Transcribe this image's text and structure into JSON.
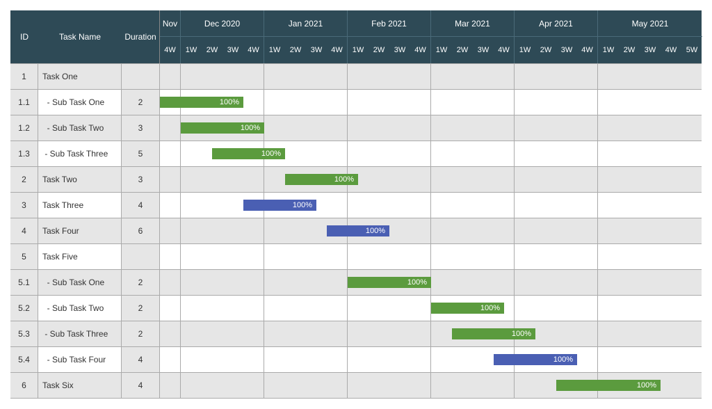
{
  "columns": {
    "id": "ID",
    "name": "Task Name",
    "duration": "Duration"
  },
  "months": [
    {
      "label": "Nov",
      "weeks": [
        "4W"
      ]
    },
    {
      "label": "Dec 2020",
      "weeks": [
        "1W",
        "2W",
        "3W",
        "4W"
      ]
    },
    {
      "label": "Jan 2021",
      "weeks": [
        "1W",
        "2W",
        "3W",
        "4W"
      ]
    },
    {
      "label": "Feb 2021",
      "weeks": [
        "1W",
        "2W",
        "3W",
        "4W"
      ]
    },
    {
      "label": "Mar 2021",
      "weeks": [
        "1W",
        "2W",
        "3W",
        "4W"
      ]
    },
    {
      "label": "Apr 2021",
      "weeks": [
        "1W",
        "2W",
        "3W",
        "4W"
      ]
    },
    {
      "label": "May 2021",
      "weeks": [
        "1W",
        "2W",
        "3W",
        "4W",
        "5W"
      ]
    }
  ],
  "tasks": [
    {
      "id": "1",
      "name": "Task One",
      "duration": "",
      "shaded": true,
      "bar": null
    },
    {
      "id": "1.1",
      "name": "  - Sub Task One",
      "duration": "2",
      "shaded": false,
      "bar": {
        "start": 0,
        "span": 4,
        "color": "green",
        "label": "100%"
      }
    },
    {
      "id": "1.2",
      "name": "  - Sub Task Two",
      "duration": "3",
      "shaded": true,
      "bar": {
        "start": 1,
        "span": 4,
        "color": "green",
        "label": "100%"
      }
    },
    {
      "id": "1.3",
      "name": " - Sub Task Three",
      "duration": "5",
      "shaded": false,
      "bar": {
        "start": 2.5,
        "span": 3.5,
        "color": "green",
        "label": "100%"
      }
    },
    {
      "id": "2",
      "name": "Task Two",
      "duration": "3",
      "shaded": true,
      "bar": {
        "start": 6,
        "span": 3.5,
        "color": "green",
        "label": "100%"
      }
    },
    {
      "id": "3",
      "name": "Task Three",
      "duration": "4",
      "shaded": false,
      "bar": {
        "start": 4,
        "span": 3.5,
        "color": "blue",
        "label": "100%"
      }
    },
    {
      "id": "4",
      "name": "Task Four",
      "duration": "6",
      "shaded": true,
      "bar": {
        "start": 8,
        "span": 3,
        "color": "blue",
        "label": "100%"
      }
    },
    {
      "id": "5",
      "name": "Task Five",
      "duration": "",
      "shaded": false,
      "bar": null
    },
    {
      "id": "5.1",
      "name": "  - Sub Task One",
      "duration": "2",
      "shaded": true,
      "bar": {
        "start": 9,
        "span": 4,
        "color": "green",
        "label": "100%"
      }
    },
    {
      "id": "5.2",
      "name": "  - Sub Task Two",
      "duration": "2",
      "shaded": false,
      "bar": {
        "start": 13,
        "span": 3.5,
        "color": "green",
        "label": "100%"
      }
    },
    {
      "id": "5.3",
      "name": " - Sub Task Three",
      "duration": "2",
      "shaded": true,
      "bar": {
        "start": 14,
        "span": 4,
        "color": "green",
        "label": "100%"
      }
    },
    {
      "id": "5.4",
      "name": "  - Sub Task Four",
      "duration": "4",
      "shaded": false,
      "bar": {
        "start": 16,
        "span": 4,
        "color": "blue",
        "label": "100%"
      }
    },
    {
      "id": "6",
      "name": "Task Six",
      "duration": "4",
      "shaded": true,
      "bar": {
        "start": 19,
        "span": 5,
        "color": "green",
        "label": "100%"
      }
    }
  ],
  "chart_data": {
    "type": "gantt",
    "time_unit": "week",
    "week_columns": 26,
    "start_label": "Nov 4W",
    "tasks": [
      {
        "id": "1",
        "name": "Task One",
        "duration_weeks": null
      },
      {
        "id": "1.1",
        "name": "Sub Task One",
        "duration_weeks": 2,
        "start_week": 0,
        "progress": 100,
        "series": "green"
      },
      {
        "id": "1.2",
        "name": "Sub Task Two",
        "duration_weeks": 3,
        "start_week": 1,
        "progress": 100,
        "series": "green"
      },
      {
        "id": "1.3",
        "name": "Sub Task Three",
        "duration_weeks": 5,
        "start_week": 2.5,
        "progress": 100,
        "series": "green"
      },
      {
        "id": "2",
        "name": "Task Two",
        "duration_weeks": 3,
        "start_week": 6,
        "progress": 100,
        "series": "green"
      },
      {
        "id": "3",
        "name": "Task Three",
        "duration_weeks": 4,
        "start_week": 4,
        "progress": 100,
        "series": "blue"
      },
      {
        "id": "4",
        "name": "Task Four",
        "duration_weeks": 6,
        "start_week": 8,
        "progress": 100,
        "series": "blue"
      },
      {
        "id": "5",
        "name": "Task Five",
        "duration_weeks": null
      },
      {
        "id": "5.1",
        "name": "Sub Task One",
        "duration_weeks": 2,
        "start_week": 9,
        "progress": 100,
        "series": "green"
      },
      {
        "id": "5.2",
        "name": "Sub Task Two",
        "duration_weeks": 2,
        "start_week": 13,
        "progress": 100,
        "series": "green"
      },
      {
        "id": "5.3",
        "name": "Sub Task Three",
        "duration_weeks": 2,
        "start_week": 14,
        "progress": 100,
        "series": "green"
      },
      {
        "id": "5.4",
        "name": "Sub Task Four",
        "duration_weeks": 4,
        "start_week": 16,
        "progress": 100,
        "series": "blue"
      },
      {
        "id": "6",
        "name": "Task Six",
        "duration_weeks": 4,
        "start_week": 19,
        "progress": 100,
        "series": "green"
      }
    ]
  }
}
